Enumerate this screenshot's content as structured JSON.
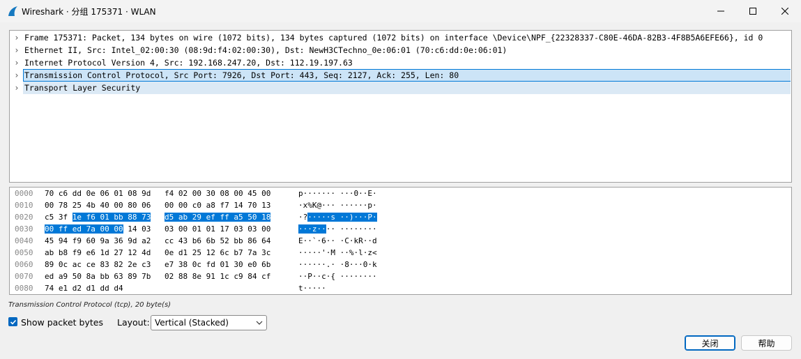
{
  "window": {
    "title": "Wireshark · 分组 175371 · WLAN"
  },
  "tree": [
    {
      "text": "Frame 175371: Packet, 134 bytes on wire (1072 bits), 134 bytes captured (1072 bits) on interface \\Device\\NPF_{22328337-C80E-46DA-82B3-4F8B5A6EFE66}, id 0"
    },
    {
      "text": "Ethernet II, Src: Intel_02:00:30 (08:9d:f4:02:00:30), Dst: NewH3CTechno_0e:06:01 (70:c6:dd:0e:06:01)"
    },
    {
      "text": "Internet Protocol Version 4, Src: 192.168.247.20, Dst: 112.19.197.63"
    },
    {
      "text": "Transmission Control Protocol, Src Port: 7926, Dst Port: 443, Seq: 2127, Ack: 255, Len: 80"
    },
    {
      "text": "Transport Layer Security"
    }
  ],
  "bytes": {
    "offsets": [
      "0000",
      "0010",
      "0020",
      "0030",
      "0040",
      "0050",
      "0060",
      "0070",
      "0080"
    ],
    "rows": [
      {
        "hex_a": "70 c6 dd 0e 06 01 08 9d",
        "hex_b": "f4 02 00 30 08 00 45 00",
        "ascii": "p······· ···0··E·"
      },
      {
        "hex_a": "00 78 25 4b 40 00 80 06",
        "hex_b": "00 00 c0 a8 f7 14 70 13",
        "ascii": "·x%K@··· ······p·"
      },
      {
        "hex_a_pre": "c5 3f ",
        "hex_a_hl": "1e f6 01 bb 88 73",
        "hex_b_hl": "d5 ab 29 ef ff a5 50 18",
        "ascii_pre": "·?",
        "ascii_hl": "·····s ··)···P·"
      },
      {
        "hex_a_hl": "00 ff ed 7a 00 00",
        "hex_a_post": " 14 03",
        "hex_b": "03 00 01 01 17 03 03 00",
        "ascii_hl": "···z··",
        "ascii_post": "·· ········"
      },
      {
        "hex_a": "45 94 f9 60 9a 36 9d a2",
        "hex_b": "cc 43 b6 6b 52 bb 86 64",
        "ascii": "E··`·6·· ·C·kR··d"
      },
      {
        "hex_a": "ab b8 f9 e6 1d 27 12 4d",
        "hex_b": "0e d1 25 12 6c b7 7a 3c",
        "ascii": "·····'·M ··%·l·z<"
      },
      {
        "hex_a": "89 0c ac ce 83 82 2e c3",
        "hex_b": "e7 38 0c fd 01 30 e0 6b",
        "ascii": "······.· ·8···0·k"
      },
      {
        "hex_a": "ed a9 50 8a bb 63 89 7b",
        "hex_b": "02 88 8e 91 1c c9 84 cf",
        "ascii": "··P··c·{ ········"
      },
      {
        "hex_a": "74 e1 d2 d1 dd d4",
        "hex_b": "",
        "ascii": "t·····"
      }
    ]
  },
  "status": "Transmission Control Protocol (tcp), 20 byte(s)",
  "options": {
    "show_bytes_label": "Show packet bytes",
    "show_bytes_checked": true,
    "layout_label": "Layout:",
    "layout_value": "Vertical (Stacked)"
  },
  "buttons": {
    "close": "关闭",
    "help": "帮助"
  },
  "colors": {
    "accent": "#0078d7",
    "selection_bg": "#cce4f7"
  }
}
